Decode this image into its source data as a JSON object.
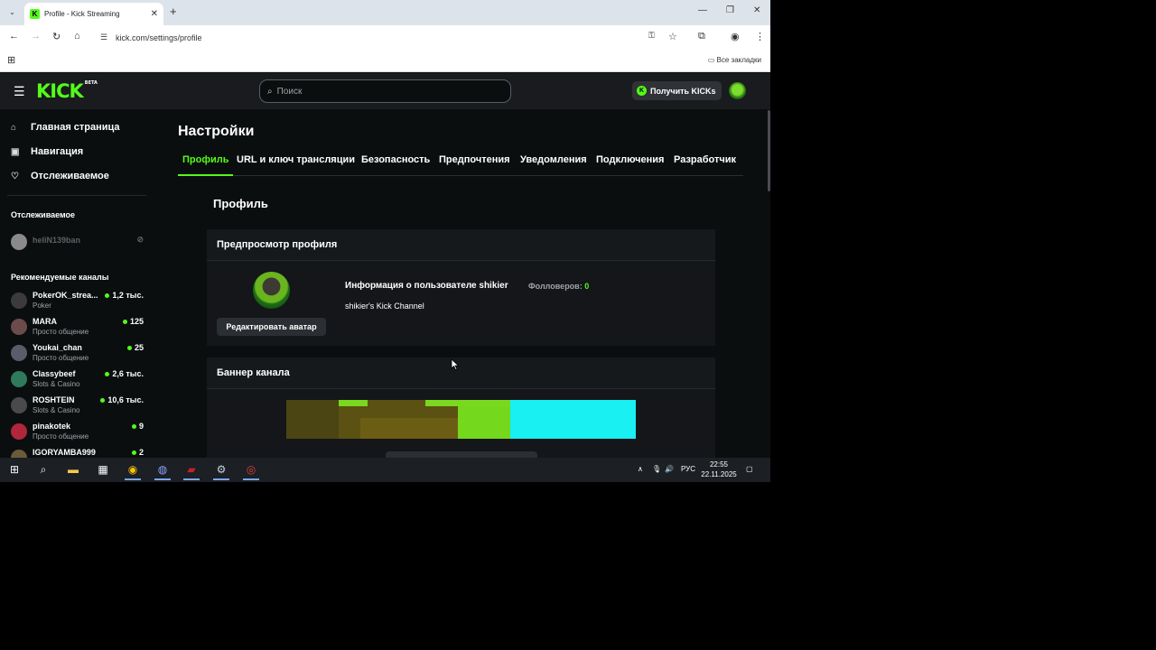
{
  "browser": {
    "tab_title": "Profile - Kick Streaming",
    "tab_favicon": "K",
    "url": "kick.com/settings/profile",
    "bookmarks_all": "Все закладки"
  },
  "header": {
    "logo": "KICK",
    "logo_badge": "BETA",
    "search_placeholder": "Поиск",
    "get_kicks": "Получить KICKs",
    "accent": "#53fc18"
  },
  "sidebar": {
    "nav": [
      {
        "label": "Главная страница",
        "icon": "home-icon"
      },
      {
        "label": "Навигация",
        "icon": "browse-icon"
      },
      {
        "label": "Отслеживаемое",
        "icon": "heart-icon"
      }
    ],
    "following_title": "Отслеживаемое",
    "following": [
      {
        "name": "heliN139ban"
      }
    ],
    "recommended_title": "Рекомендуемые каналы",
    "channels": [
      {
        "name": "PokerOK_strea...",
        "category": "Poker",
        "viewers": "1,2 тыс."
      },
      {
        "name": "MARA",
        "category": "Просто общение",
        "viewers": "125"
      },
      {
        "name": "Youkai_chan",
        "category": "Просто общение",
        "viewers": "25"
      },
      {
        "name": "Classybeef",
        "category": "Slots & Casino",
        "viewers": "2,6 тыс."
      },
      {
        "name": "ROSHTEIN",
        "category": "Slots & Casino",
        "viewers": "10,6 тыс."
      },
      {
        "name": "pinakotek",
        "category": "Просто общение",
        "viewers": "9"
      },
      {
        "name": "IGORYAMBA999",
        "category": "",
        "viewers": "2"
      }
    ]
  },
  "settings": {
    "title": "Настройки",
    "tabs": [
      "Профиль",
      "URL и ключ трансляции",
      "Безопасность",
      "Предпочтения",
      "Уведомления",
      "Подключения",
      "Разработчик"
    ],
    "section_title": "Профиль",
    "preview_title": "Предпросмотр профиля",
    "edit_avatar": "Редактировать аватар",
    "user_info_title": "Информация о пользователе shikier",
    "followers_label": "Фолловеров:",
    "followers_value": "0",
    "user_desc": "shikier's Kick Channel",
    "banner_title": "Баннер канала"
  },
  "taskbar": {
    "lang": "РУС",
    "time": "22:55",
    "date": "22.11.2025"
  }
}
